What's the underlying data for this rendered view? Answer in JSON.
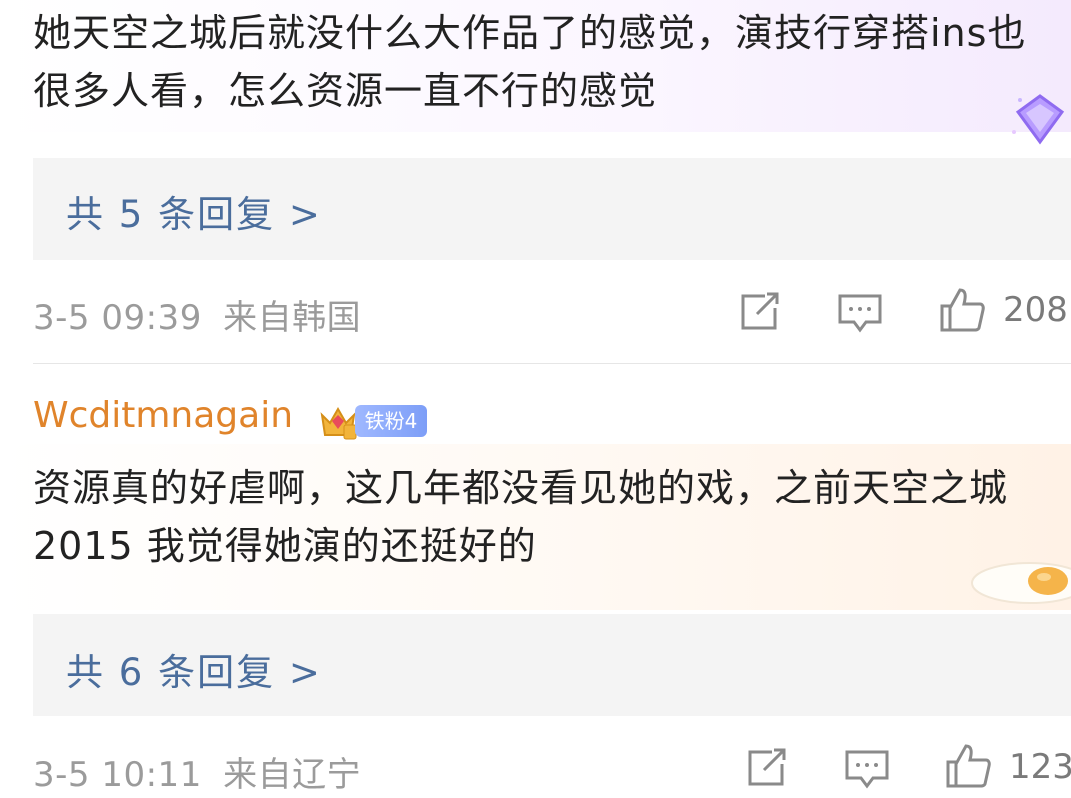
{
  "comments": [
    {
      "text": "她天空之城后就没什么大作品了的感觉，演技行穿搭ins也很多人看，怎么资源一直不行的感觉",
      "reply_link": "共 5 条回复 >",
      "time": "3-5 09:39",
      "location": "来自韩国",
      "likes": "208"
    },
    {
      "username": "Wcditmnagain",
      "badge": "铁粉4",
      "text": "资源真的好虐啊，这几年都没看见她的戏，之前天空之城 2015 我觉得她演的还挺好的",
      "reply_link": "共 6 条回复 >",
      "time": "3-5 10:11",
      "location": "来自辽宁",
      "likes": "123"
    }
  ],
  "icons": [
    "share-icon",
    "comment-icon",
    "like-icon",
    "crown-badge-icon",
    "diamond-decoration-icon",
    "egg-decoration-icon"
  ],
  "colors": {
    "username": "#e0842b",
    "reply_link": "#4a6d9c",
    "badge": "#7d9ef7",
    "meta": "#9b9b9b"
  }
}
